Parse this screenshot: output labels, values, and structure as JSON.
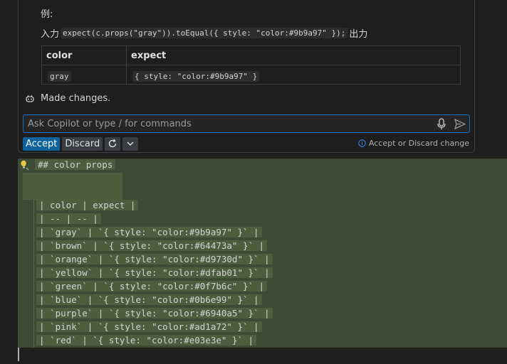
{
  "chat": {
    "example_label": "例:",
    "input_prefix": "入力",
    "example_code": "expect(c.props(\"gray\")).toEqual({ style: \"color:#9b9a97\" });",
    "output_suffix": "出力",
    "table": {
      "headers": [
        "color",
        "expect"
      ],
      "rows": [
        [
          "gray",
          "{ style: \"color:#9b9a97\" }"
        ]
      ]
    },
    "made_changes": "Made changes.",
    "input_placeholder": "Ask Copilot or type / for commands",
    "accept_label": "Accept",
    "discard_label": "Discard",
    "info_text": "Accept or Discard change"
  },
  "editor": {
    "lines": [
      "## color props",
      "",
      "| color | expect |",
      "| -- | -- |",
      "| `gray` | `{ style: \"color:#9b9a97\" }` |",
      "| `brown` | `{ style: \"color:#64473a\" }` |",
      "| `orange` | `{ style: \"color:#d9730d\" }` |",
      "| `yellow` | `{ style: \"color:#dfab01\" }` |",
      "| `green` | `{ style: \"color:#0f7b6c\" }` |",
      "| `blue` | `{ style: \"color:#0b6e99\" }` |",
      "| `purple` | `{ style: \"color:#6940a5\" }` |",
      "| `pink` | `{ style: \"color:#ad1a72\" }` |",
      "| `red` | `{ style: \"color:#e03e3e\" }` |"
    ]
  },
  "icons": [
    "copilot-icon",
    "mic-icon",
    "send-icon",
    "refresh-icon",
    "chevron-down-icon",
    "info-icon",
    "lightbulb-icon"
  ],
  "colors": {
    "accent": "#0e639c",
    "focus_border": "#0e72c9",
    "diff_highlight": "#3c4b33"
  }
}
